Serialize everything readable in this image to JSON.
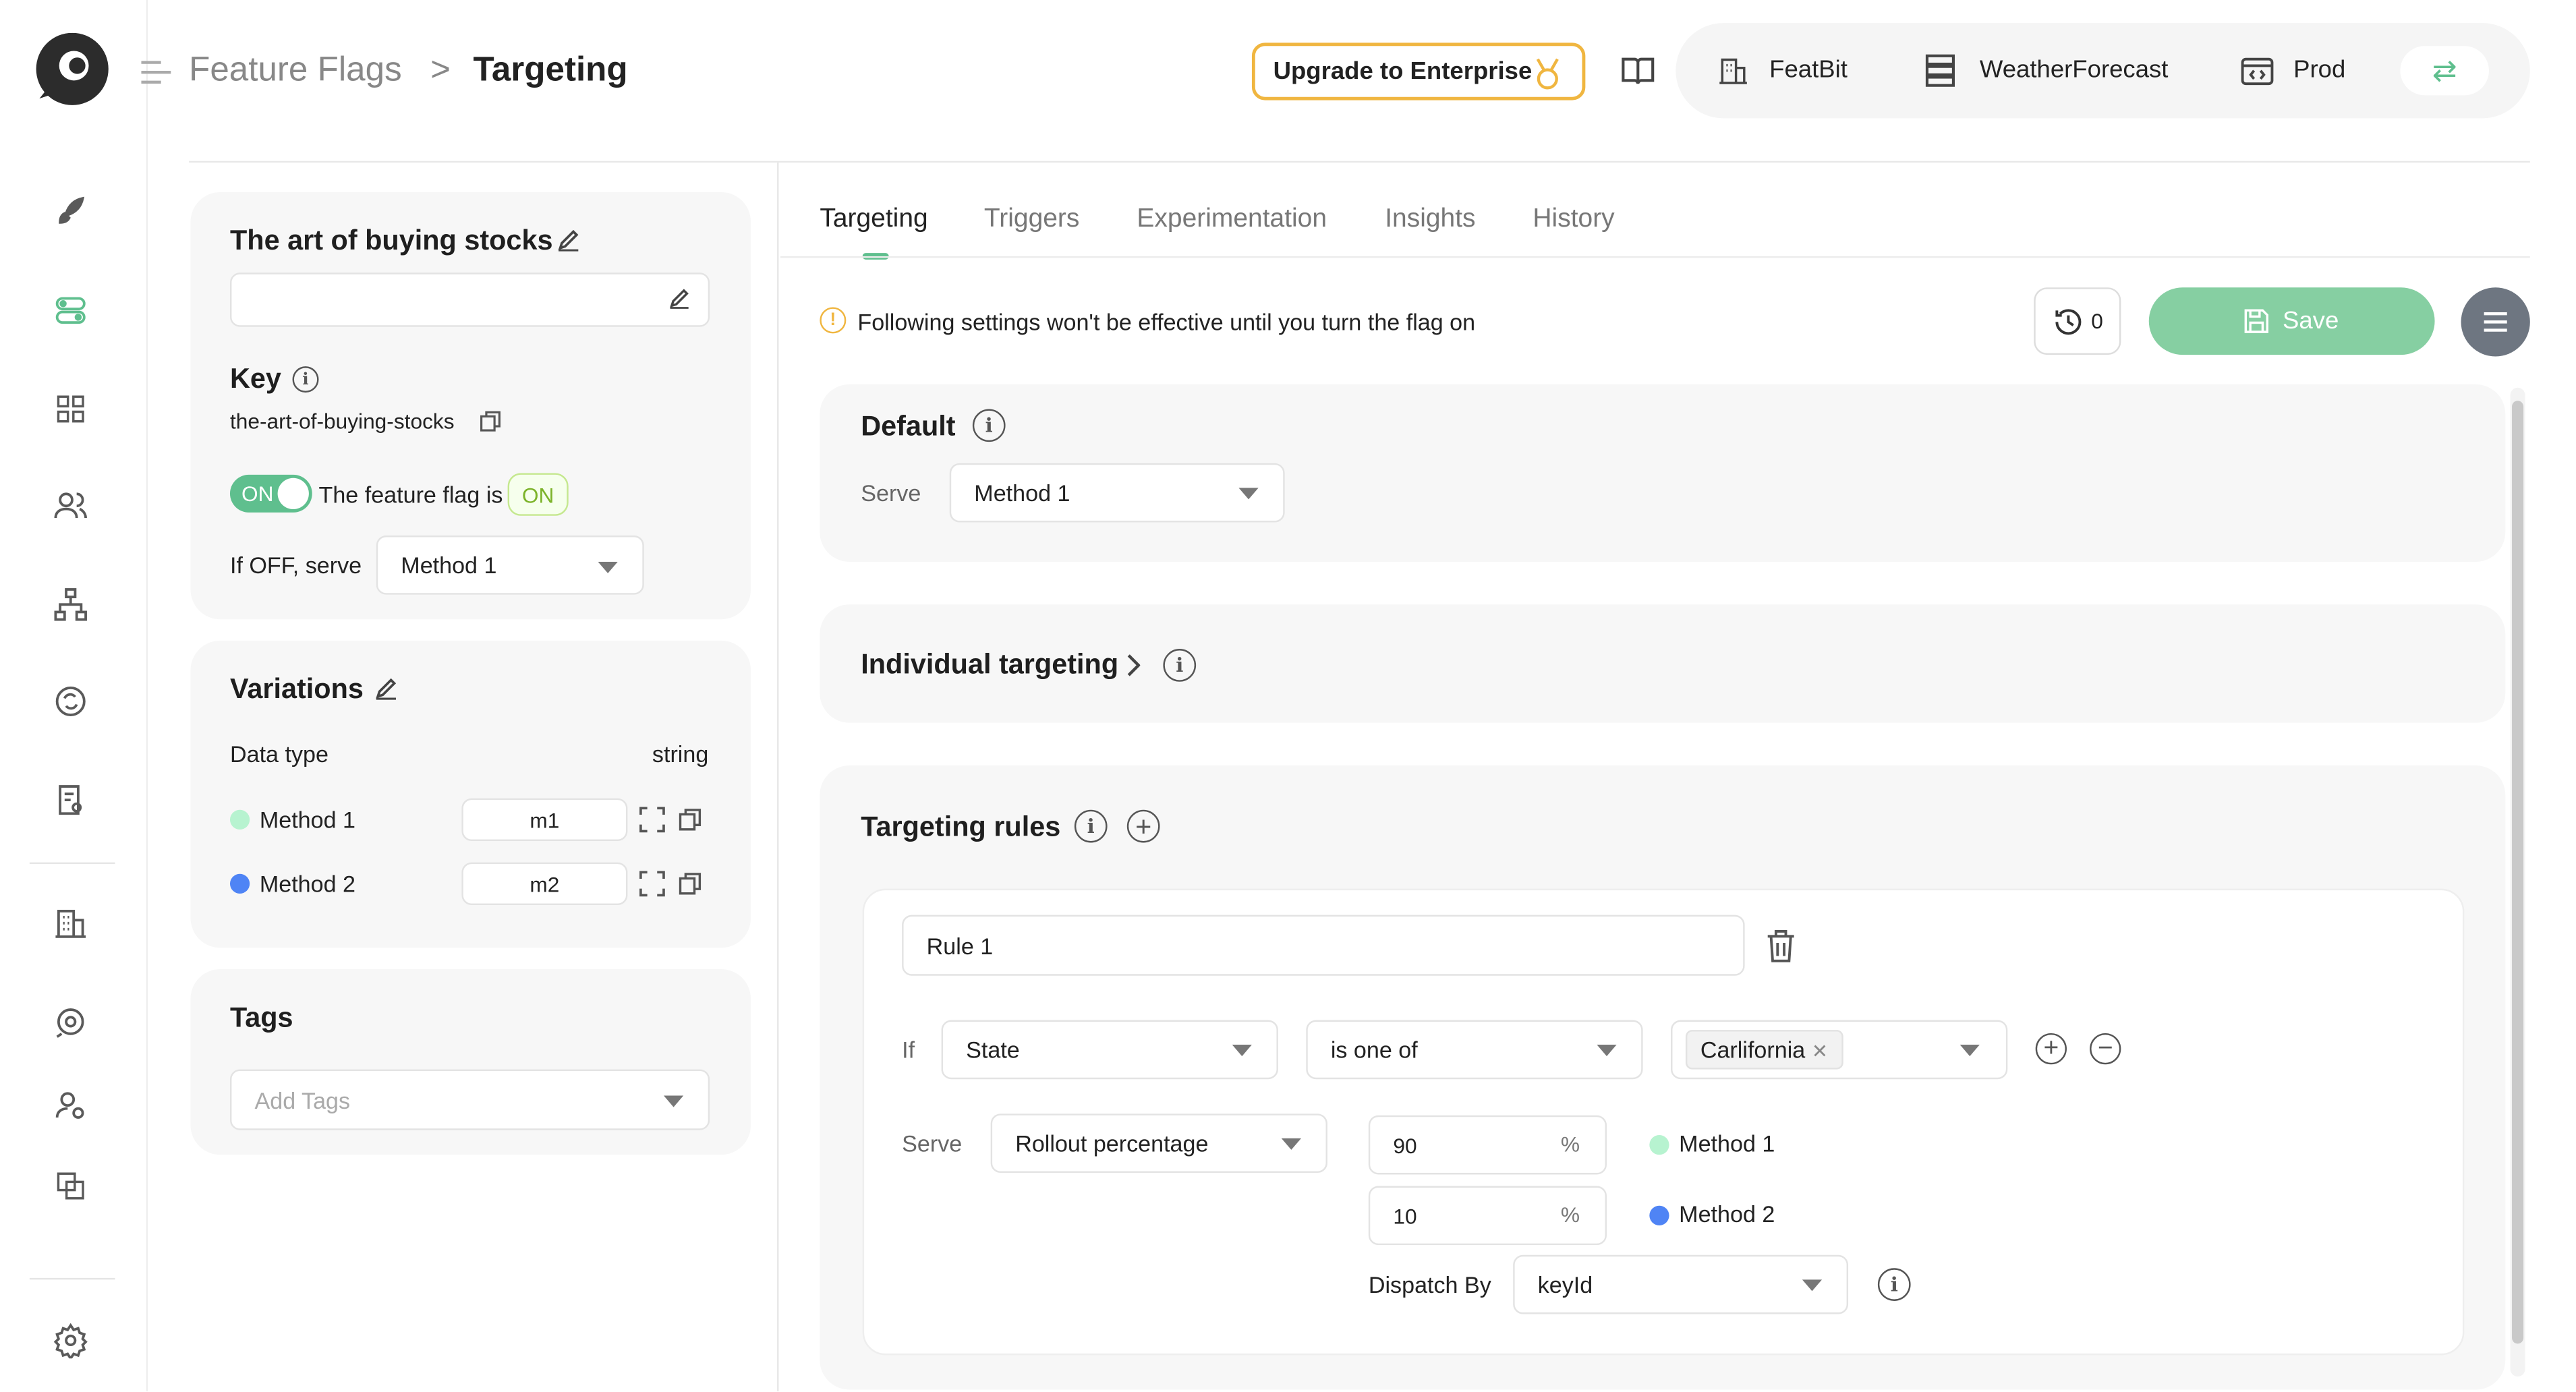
{
  "header": {
    "breadcrumb_parent": "Feature Flags",
    "breadcrumb_sep": ">",
    "breadcrumb_current": "Targeting",
    "upgrade_label": "Upgrade to Enterprise",
    "org": "FeatBit",
    "project": "WeatherForecast",
    "env": "Prod"
  },
  "flag": {
    "name": "The art of buying stocks",
    "description": "",
    "key_label": "Key",
    "key": "the-art-of-buying-stocks",
    "toggle_label": "ON",
    "status_text": "The feature flag is",
    "status_badge": "ON",
    "off_serve_label": "If OFF, serve",
    "off_serve_value": "Method 1"
  },
  "variations": {
    "title": "Variations",
    "data_type_label": "Data type",
    "data_type_value": "string",
    "items": [
      {
        "name": "Method 1",
        "value": "m1",
        "color": "#b7f3d0"
      },
      {
        "name": "Method 2",
        "value": "m2",
        "color": "#4f84f5"
      }
    ]
  },
  "tags": {
    "title": "Tags",
    "placeholder": "Add Tags"
  },
  "tabs": [
    "Targeting",
    "Triggers",
    "Experimentation",
    "Insights",
    "History"
  ],
  "notice": "Following settings won't be effective until you turn the flag on",
  "history_count": "0",
  "save_label": "Save",
  "default_section": {
    "title": "Default",
    "serve_label": "Serve",
    "serve_value": "Method 1"
  },
  "individual": {
    "title": "Individual targeting"
  },
  "rules": {
    "title": "Targeting rules",
    "rule_name": "Rule 1",
    "if_label": "If",
    "attribute": "State",
    "operator": "is one of",
    "value_tag": "Carlifornia",
    "serve_label": "Serve",
    "serve_mode": "Rollout percentage",
    "rollout": [
      {
        "percent": "90",
        "unit": "%",
        "variation": "Method 1"
      },
      {
        "percent": "10",
        "unit": "%",
        "variation": "Method 2"
      }
    ],
    "dispatch_label": "Dispatch By",
    "dispatch_value": "keyId"
  },
  "colors": {
    "accent": "#5fbf8e",
    "warning": "#f0b640"
  }
}
